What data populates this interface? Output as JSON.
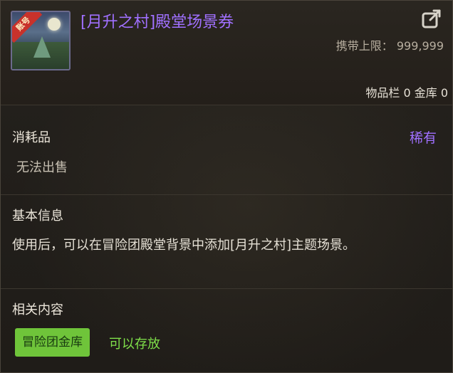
{
  "item": {
    "title": "[月升之村]殿堂场景券",
    "icon_badge": "账号",
    "icon": "landscape-icon",
    "carry_limit_label": "携带上限：",
    "carry_limit_value": "999,999",
    "storage_text": "物品栏 0 金库 0"
  },
  "category": {
    "type": "消耗品",
    "rarity": "稀有",
    "sell_status": "无法出售"
  },
  "basic_info": {
    "heading": "基本信息",
    "description": "使用后，可以在冒险团殿堂背景中添加[月升之村]主题场景。"
  },
  "related": {
    "heading": "相关内容",
    "tag_label": "冒险团金库",
    "tag_note": "可以存放"
  },
  "colors": {
    "title": "#a070ff",
    "rarity": "#a070ff",
    "tag_bg": "#6fc43a",
    "tag_note": "#7fe04a"
  }
}
